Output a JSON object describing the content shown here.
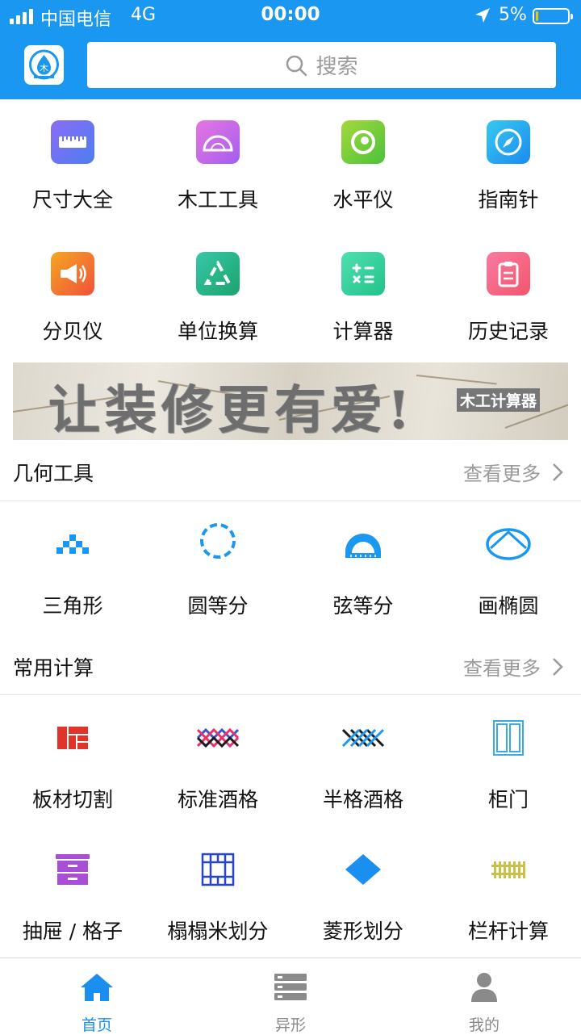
{
  "status_bar": {
    "carrier": "中国电信",
    "network": "4G",
    "time": "00:00",
    "battery_percent": "5%",
    "battery_level": 0.05
  },
  "header": {
    "logo_text": "木",
    "search_placeholder": "搜索"
  },
  "tools": [
    {
      "label": "尺寸大全",
      "icon": "ruler-icon"
    },
    {
      "label": "木工工具",
      "icon": "protractor-icon"
    },
    {
      "label": "水平仪",
      "icon": "level-icon"
    },
    {
      "label": "指南针",
      "icon": "compass-icon"
    },
    {
      "label": "分贝仪",
      "icon": "megaphone-icon"
    },
    {
      "label": "单位换算",
      "icon": "recycle-icon"
    },
    {
      "label": "计算器",
      "icon": "calculator-icon"
    },
    {
      "label": "历史记录",
      "icon": "clipboard-icon"
    }
  ],
  "banner": {
    "title": "让装修更有爱!",
    "tag": "木工计算器"
  },
  "geometry": {
    "title": "几何工具",
    "more": "查看更多",
    "items": [
      {
        "label": "三角形",
        "icon": "triangle-pixels-icon"
      },
      {
        "label": "圆等分",
        "icon": "dashed-circle-icon"
      },
      {
        "label": "弦等分",
        "icon": "semicircle-icon"
      },
      {
        "label": "画椭圆",
        "icon": "ellipse-icon"
      }
    ]
  },
  "calc": {
    "title": "常用计算",
    "more": "查看更多",
    "items": [
      {
        "label": "板材切割",
        "icon": "board-cut-icon"
      },
      {
        "label": "标准酒格",
        "icon": "wine-rack-icon"
      },
      {
        "label": "半格酒格",
        "icon": "half-wine-rack-icon"
      },
      {
        "label": "柜门",
        "icon": "cabinet-door-icon"
      },
      {
        "label": "抽屉 / 格子",
        "icon": "drawer-icon"
      },
      {
        "label": "榻榻米划分",
        "icon": "tatami-icon"
      },
      {
        "label": "菱形划分",
        "icon": "diamond-icon"
      },
      {
        "label": "栏杆计算",
        "icon": "railing-icon"
      }
    ]
  },
  "tabbar": [
    {
      "label": "首页",
      "icon": "home-icon",
      "active": true
    },
    {
      "label": "异形",
      "icon": "server-icon",
      "active": false
    },
    {
      "label": "我的",
      "icon": "user-icon",
      "active": false
    }
  ],
  "colors": {
    "brand": "#1a97f0",
    "tab_active": "#1a8ff0",
    "tab_inactive": "#8a8a8a"
  }
}
